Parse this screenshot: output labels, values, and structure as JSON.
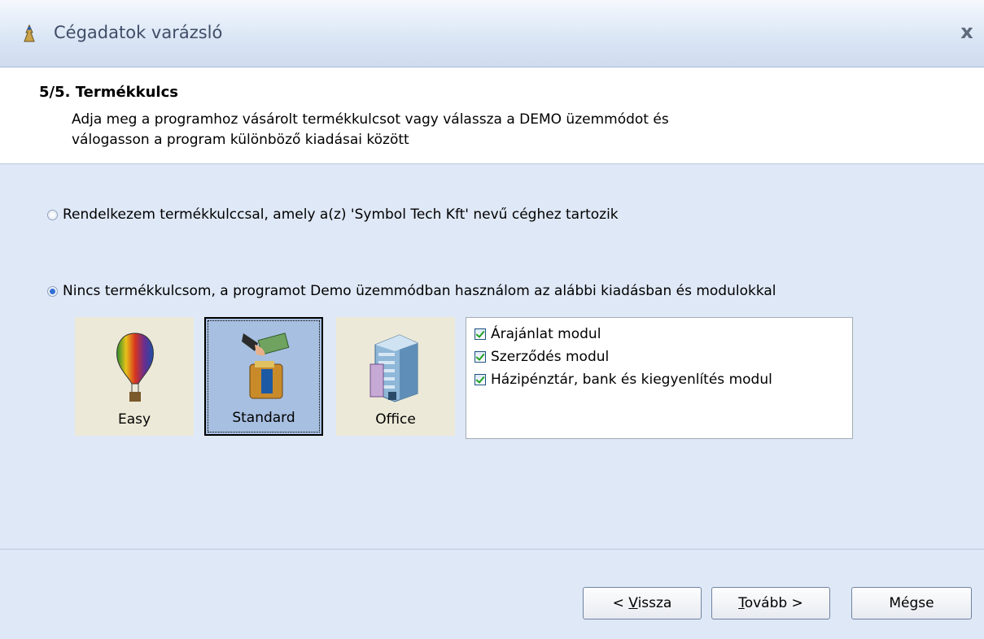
{
  "window": {
    "title": "Cégadatok varázsló",
    "close_label": "x"
  },
  "header": {
    "step_title": "5/5. Termékkulcs",
    "description_line1": "Adja meg a programhoz vásárolt termékkulcsot vagy válassza a DEMO üzemmódot és",
    "description_line2": "válogasson a program különböző kiadásai között"
  },
  "options": {
    "have_key": {
      "label": "Rendelkezem termékkulccsal, amely a(z) 'Symbol Tech Kft' nevű céghez tartozik",
      "checked": false
    },
    "demo": {
      "label": "Nincs termékkulcsom, a programot Demo üzemmódban használom az alábbi kiadásban és modulokkal",
      "checked": true
    }
  },
  "editions": [
    {
      "label": "Easy",
      "icon": "balloon-icon",
      "selected": false
    },
    {
      "label": "Standard",
      "icon": "money-wallet-icon",
      "selected": true
    },
    {
      "label": "Office",
      "icon": "office-building-icon",
      "selected": false
    }
  ],
  "modules": [
    {
      "label": "Árajánlat modul",
      "checked": true
    },
    {
      "label": "Szerződés modul",
      "checked": true
    },
    {
      "label": "Házipénztár, bank és kiegyenlítés modul",
      "checked": true
    }
  ],
  "buttons": {
    "back_prefix": "< ",
    "back_underlined": "V",
    "back_rest": "issza",
    "next_underlined": "T",
    "next_rest": "ovább >",
    "cancel": "Mégse"
  },
  "colors": {
    "background": "#dfe8f6",
    "selected_tile": "#a7bfe0",
    "tile": "#ece9d8"
  }
}
